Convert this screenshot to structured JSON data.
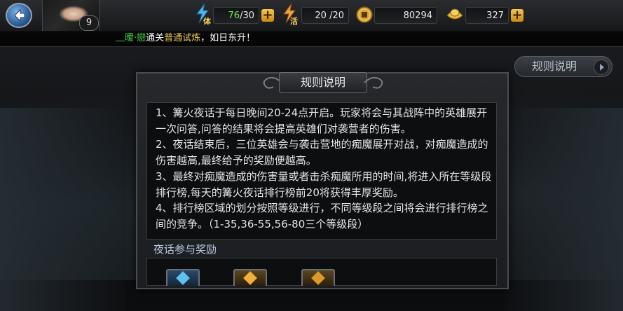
{
  "header": {
    "level": "9",
    "stamina": {
      "label": "体",
      "current": "76",
      "max": "/30"
    },
    "energy": {
      "label": "活",
      "value": "20 /20"
    },
    "coins": "80294",
    "gold": "327"
  },
  "broadcast": {
    "player": "﹏暧·戀",
    "text1": "通关",
    "stage": "普通试炼",
    "text2": "，如日东升！"
  },
  "rules_button": {
    "label": "规则说明"
  },
  "panel": {
    "title": "规则说明",
    "rules": [
      "1、篝火夜话于每日晚间20-24点开启。玩家将会与其战阵中的英雄展开一次问答,问答的结果将会提高英雄们对袭营者的伤害。",
      "2、夜话结束后，三位英雄会与袭击营地的痴魔展开对战，对痴魔造成的伤害越高,最终给予的奖励便越高。",
      "3、最终对痴魔造成的伤害量或者击杀痴魔所用的时间,将进入所在等级段排行榜,每天的篝火夜话排行榜前20将获得丰厚奖励。",
      "4、排行榜区域的划分按照等级进行，不同等级段之间将会进行排行榜之间的竞争。（1-35,36-55,56-80三个等级段）"
    ],
    "reward_label": "夜话参与奖励"
  },
  "colors": {
    "accent_green": "#7de34f",
    "gold_text": "#f1c94d",
    "name_green": "#45d545",
    "button_gold": "#e0a52a"
  }
}
